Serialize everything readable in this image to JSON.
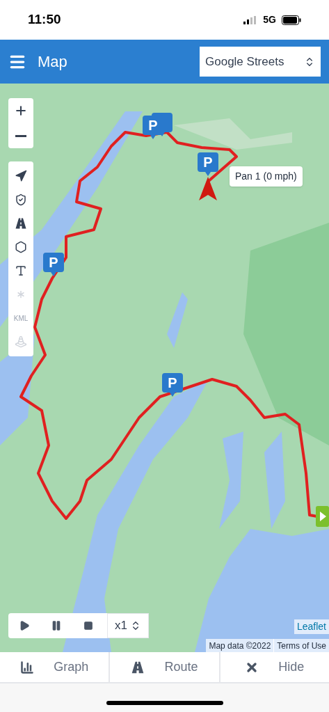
{
  "status_bar": {
    "time": "11:50",
    "network": "5G"
  },
  "header": {
    "title": "Map",
    "layer_select": {
      "value": "Google Streets"
    }
  },
  "map": {
    "tools": [
      {
        "kind": "locate",
        "disabled": false
      },
      {
        "kind": "shield",
        "disabled": false
      },
      {
        "kind": "road",
        "disabled": false
      },
      {
        "kind": "polygon",
        "disabled": false
      },
      {
        "kind": "text",
        "disabled": false
      },
      {
        "kind": "points",
        "disabled": true
      },
      {
        "kind": "kml",
        "label": "KML",
        "disabled": true
      },
      {
        "kind": "traffic",
        "disabled": true
      }
    ],
    "markers": [
      {
        "kind": "stacked"
      },
      {
        "kind": "single",
        "label": "P"
      },
      {
        "kind": "single",
        "label": "P"
      },
      {
        "kind": "single",
        "label": "P"
      },
      {
        "kind": "single",
        "label": "P"
      }
    ],
    "tooltip": "Pan 1 (0 mph)",
    "playback": {
      "speed": "x1"
    },
    "attribution": {
      "leaflet": "Leaflet",
      "map_data": "Map data ©2022",
      "terms": "Terms of Use"
    }
  },
  "bottom_tabs": [
    {
      "label": "Graph",
      "kind": "graph"
    },
    {
      "label": "Route",
      "kind": "route"
    },
    {
      "label": "Hide",
      "kind": "hide"
    }
  ]
}
